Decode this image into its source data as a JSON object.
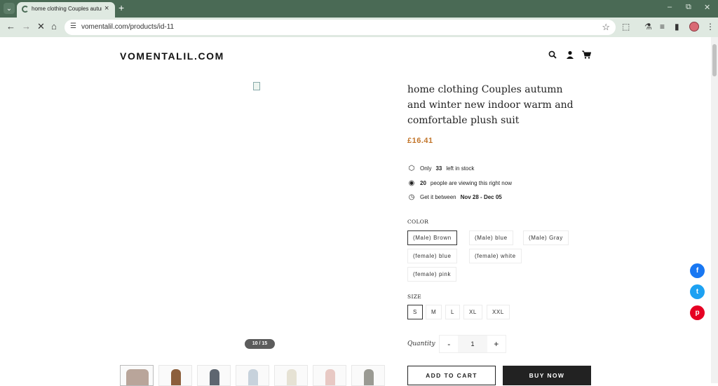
{
  "browser": {
    "tab_title": "home clothing Couples autumn",
    "tab_close": "×",
    "new_tab": "+",
    "url": "vomentalil.com/products/id-11",
    "controls": {
      "minimize": "–",
      "restore": "⧉",
      "close": "✕"
    }
  },
  "header": {
    "logo": "VOMENTALIL.COM",
    "icons": [
      "search-icon",
      "account-icon",
      "cart-icon"
    ]
  },
  "gallery": {
    "counter": "10 / 15",
    "thumbnail_colors": [
      "#b9a59a",
      "#8c5f3c",
      "#5e6670",
      "#c7d2dc",
      "#e6e2d4",
      "#e8c9c4",
      "#9a9a93"
    ]
  },
  "product": {
    "title": "home clothing Couples autumn and winter new indoor warm and comfortable plush suit",
    "price": "£16.41",
    "stock": {
      "prefix": "Only",
      "count": "33",
      "suffix": "left in stock"
    },
    "viewing": {
      "count": "20",
      "suffix": "people are viewing this right now"
    },
    "delivery": {
      "prefix": "Get it between",
      "range": "Nov 28 - Dec 05"
    },
    "color_label": "COLOR",
    "colors": [
      "(Male) Brown",
      "(Male) blue",
      "(Male) Gray",
      "(female) blue",
      "(female) white",
      "(female) pink"
    ],
    "selected_color": "(Male) Brown",
    "size_label": "SIZE",
    "sizes": [
      "S",
      "M",
      "L",
      "XL",
      "XXL"
    ],
    "selected_size": "S",
    "quantity_label": "Quantity",
    "quantity": "1",
    "minus": "-",
    "plus": "+",
    "add_to_cart": "ADD TO CART",
    "buy_now": "BUY NOW"
  },
  "share": {
    "facebook": {
      "glyph": "f",
      "color": "#1877f2"
    },
    "twitter": {
      "glyph": "t",
      "color": "#1da1f2"
    },
    "pinterest": {
      "glyph": "p",
      "color": "#e60023"
    }
  },
  "accent_color": "#c2752a"
}
